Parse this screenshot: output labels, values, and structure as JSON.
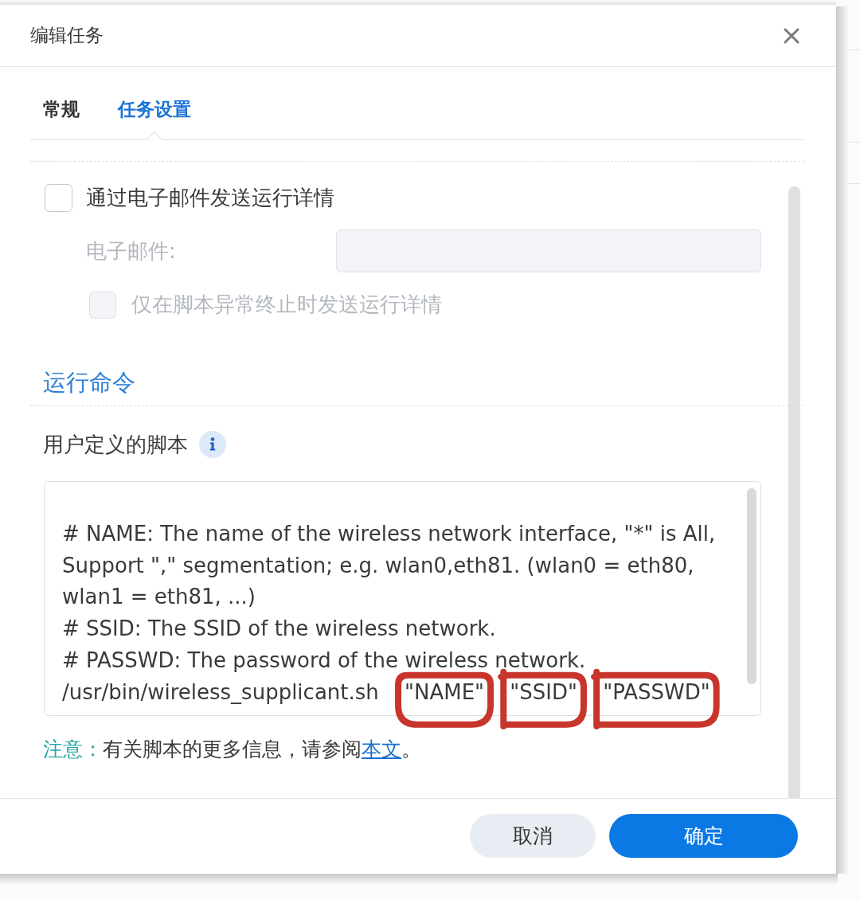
{
  "dialog": {
    "title": "编辑任务"
  },
  "tabs": [
    {
      "label": "常规",
      "selected": false
    },
    {
      "label": "任务设置",
      "selected": true
    }
  ],
  "notification": {
    "send_details": {
      "label": "通过电子邮件发送运行详情",
      "checked": false,
      "disabled": false
    },
    "email": {
      "label": "电子邮件:",
      "disabled": true
    },
    "only_on_abnormal": {
      "label": "仅在脚本异常终止时发送运行详情",
      "checked": false,
      "disabled": true
    }
  },
  "run_command": {
    "heading": "运行命令",
    "script_label": "用户定义的脚本",
    "script": "\n# NAME: The name of the wireless network interface, \"*\" is All, Support \",\" segmentation; e.g. wlan0,eth81. (wlan0 = eth80, wlan1 = eth81, ...)\n# SSID: The SSID of the wireless network.\n# PASSWD: The password of the wireless network.\n/usr/bin/wireless_supplicant.sh \"NAME\" \"SSID\" \"PASSWD\"",
    "note": {
      "label": "注意：",
      "text": "有关脚本的更多信息，请参阅",
      "link": "本文",
      "end": "。"
    }
  },
  "buttons": [
    {
      "label": "取消",
      "kind": "secondary"
    },
    {
      "label": "确定",
      "kind": "primary"
    }
  ]
}
